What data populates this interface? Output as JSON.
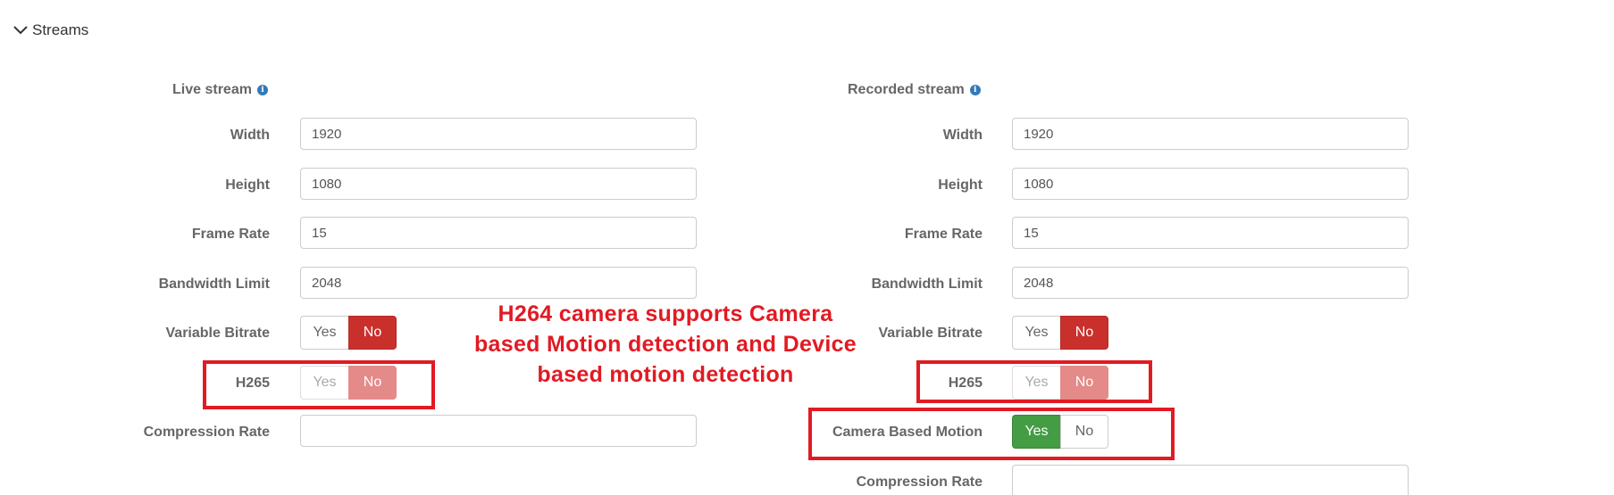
{
  "section": {
    "title": "Streams"
  },
  "live": {
    "title": "Live stream",
    "fields": {
      "width": {
        "label": "Width",
        "value": "1920"
      },
      "height": {
        "label": "Height",
        "value": "1080"
      },
      "frame_rate": {
        "label": "Frame Rate",
        "value": "15"
      },
      "bandwidth": {
        "label": "Bandwidth Limit",
        "value": "2048"
      },
      "compression": {
        "label": "Compression Rate",
        "value": ""
      }
    },
    "variable_bitrate": {
      "label": "Variable Bitrate",
      "yes": "Yes",
      "no": "No",
      "selected": "No"
    },
    "h265": {
      "label": "H265",
      "yes": "Yes",
      "no": "No",
      "selected": "No",
      "disabled": true
    }
  },
  "recorded": {
    "title": "Recorded stream",
    "fields": {
      "width": {
        "label": "Width",
        "value": "1920"
      },
      "height": {
        "label": "Height",
        "value": "1080"
      },
      "frame_rate": {
        "label": "Frame Rate",
        "value": "15"
      },
      "bandwidth": {
        "label": "Bandwidth Limit",
        "value": "2048"
      },
      "compression": {
        "label": "Compression Rate",
        "value": ""
      }
    },
    "variable_bitrate": {
      "label": "Variable Bitrate",
      "yes": "Yes",
      "no": "No",
      "selected": "No"
    },
    "h265": {
      "label": "H265",
      "yes": "Yes",
      "no": "No",
      "selected": "No",
      "disabled": true
    },
    "camera_motion": {
      "label": "Camera Based Motion",
      "yes": "Yes",
      "no": "No",
      "selected": "Yes"
    }
  },
  "annotation": {
    "line1": "H264 camera supports Camera",
    "line2": "based Motion detection and Device",
    "line3": "based motion detection"
  },
  "colors": {
    "highlight": "#e21a23",
    "no_active": "#c9302c",
    "yes_active": "#449d44",
    "info": "#337ab7"
  },
  "icons": {
    "collapse": "chevron-down-icon",
    "info": "info-icon"
  }
}
